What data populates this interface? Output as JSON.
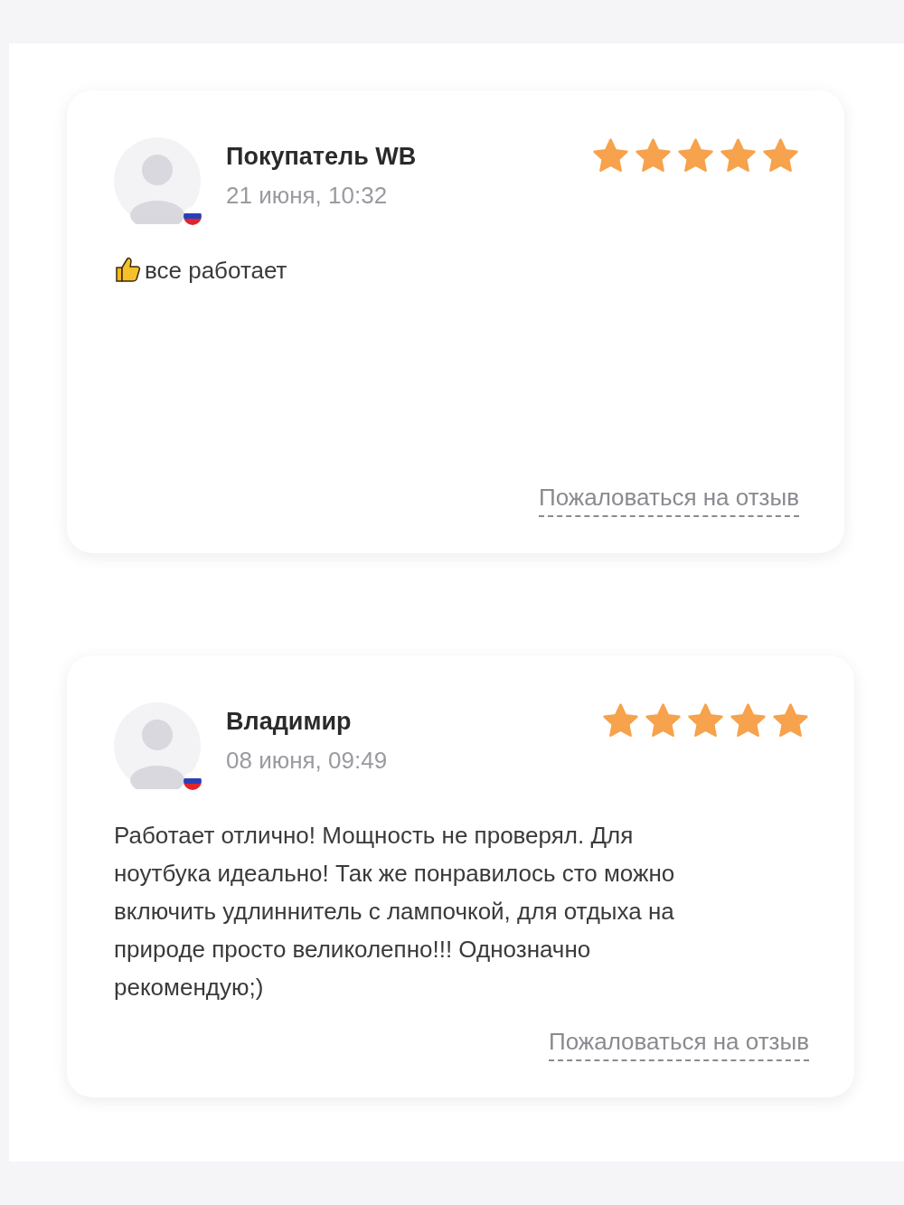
{
  "reviews": [
    {
      "author": "Покупатель WB",
      "date": "21 июня, 10:32",
      "stars": 5,
      "thumbs_up_icon": true,
      "text": "все работает",
      "complaint_link": "Пожаловаться на отзыв"
    },
    {
      "author": "Владимир",
      "date": "08 июня, 09:49",
      "stars": 5,
      "text": "Работает отлично! Мощность не проверял. Для ноутбука идеально! Так же понравилось сто можно включить удлиннитель с лампочкой, для отдыха на природе просто великолепно!!! Однозначно рекомендую;)",
      "complaint_link": "Пожаловаться на отзыв"
    }
  ]
}
